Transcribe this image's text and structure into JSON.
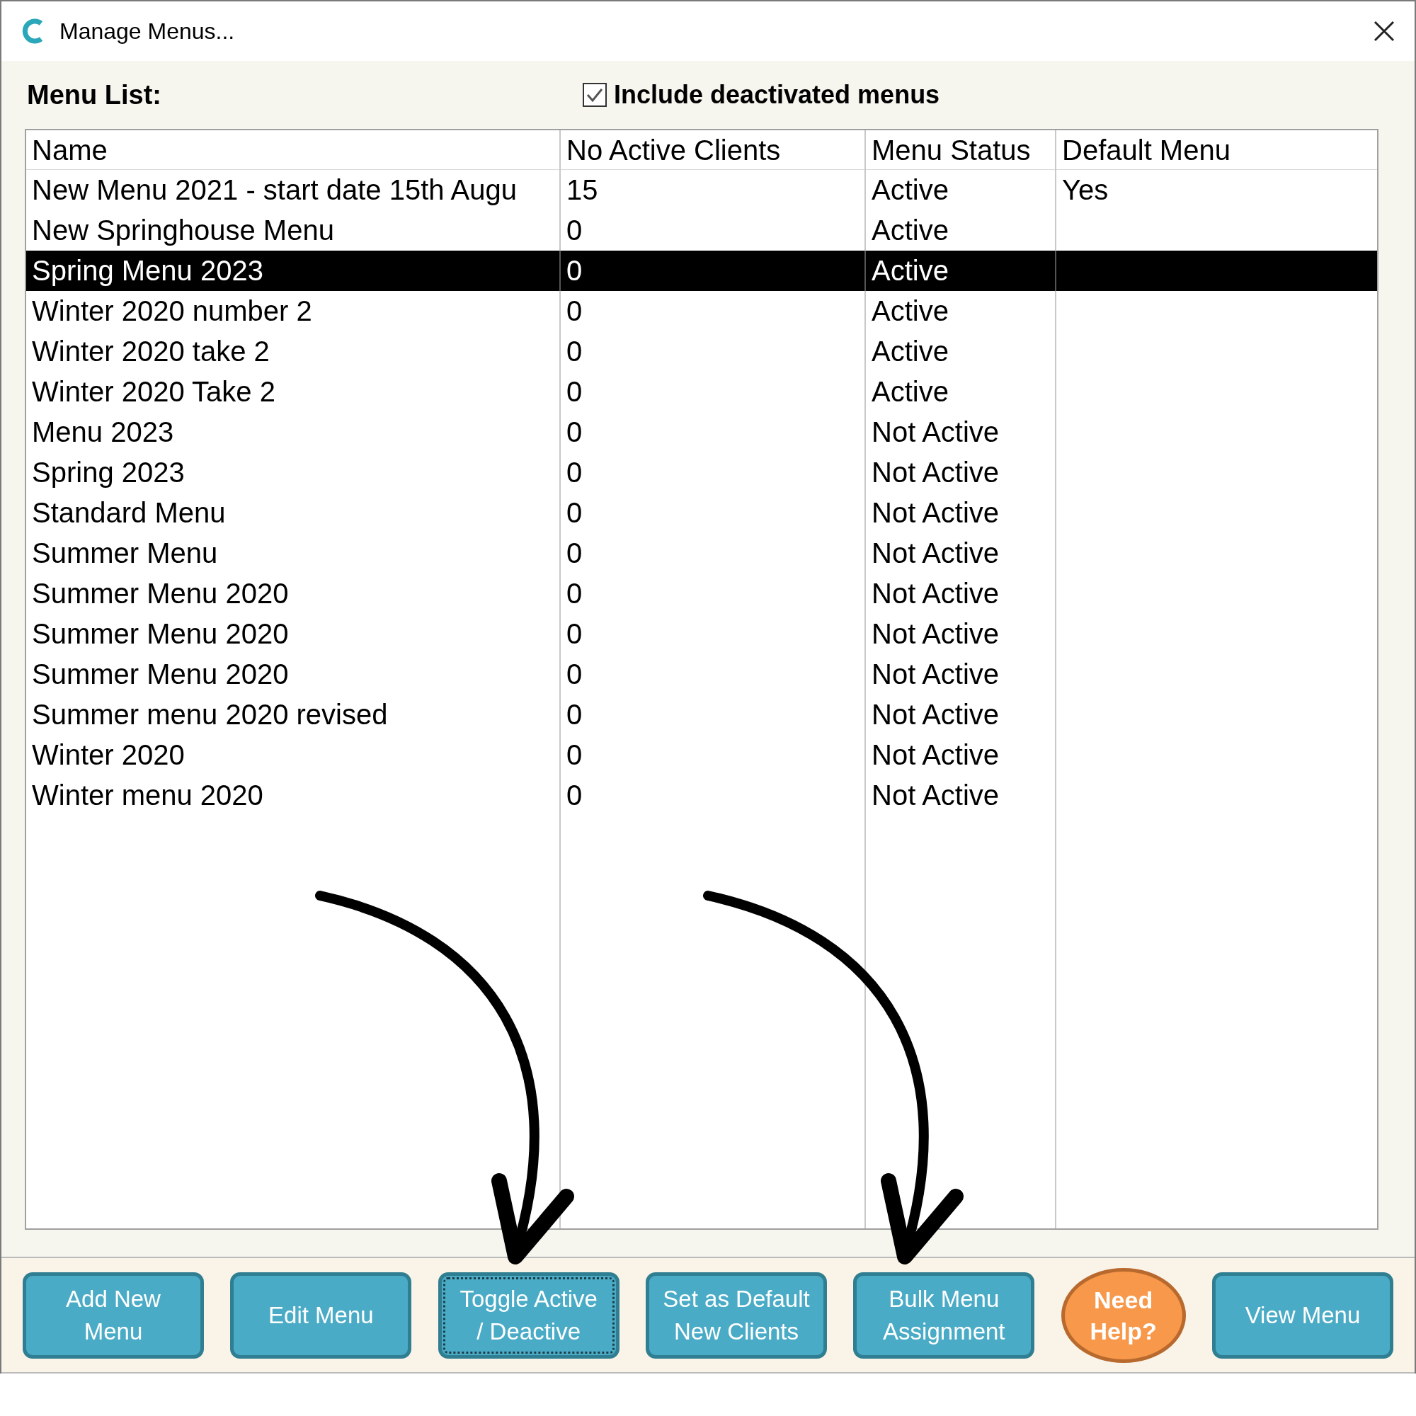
{
  "window": {
    "title": "Manage Menus..."
  },
  "menu_list": {
    "label": "Menu List:",
    "include_deactivated": {
      "label": "Include deactivated menus",
      "checked": true
    }
  },
  "table": {
    "columns": [
      "Name",
      "No Active Clients",
      "Menu Status",
      "Default Menu"
    ],
    "rows": [
      {
        "cells": [
          "New Menu 2021 - start date 15th Augu",
          "15",
          "Active",
          "Yes"
        ],
        "selected": false
      },
      {
        "cells": [
          "New Springhouse Menu",
          "0",
          "Active",
          ""
        ],
        "selected": false
      },
      {
        "cells": [
          "Spring Menu 2023",
          "0",
          "Active",
          ""
        ],
        "selected": true
      },
      {
        "cells": [
          "Winter 2020 number 2",
          "0",
          "Active",
          ""
        ],
        "selected": false
      },
      {
        "cells": [
          "Winter 2020 take 2",
          "0",
          "Active",
          ""
        ],
        "selected": false
      },
      {
        "cells": [
          "Winter 2020 Take 2",
          "0",
          "Active",
          ""
        ],
        "selected": false
      },
      {
        "cells": [
          "Menu 2023",
          "0",
          "Not Active",
          ""
        ],
        "selected": false
      },
      {
        "cells": [
          "Spring 2023",
          "0",
          "Not Active",
          ""
        ],
        "selected": false
      },
      {
        "cells": [
          "Standard Menu",
          "0",
          "Not Active",
          ""
        ],
        "selected": false
      },
      {
        "cells": [
          "Summer Menu",
          "0",
          "Not Active",
          ""
        ],
        "selected": false
      },
      {
        "cells": [
          "Summer Menu 2020",
          "0",
          "Not Active",
          ""
        ],
        "selected": false
      },
      {
        "cells": [
          "Summer Menu 2020",
          "0",
          "Not Active",
          ""
        ],
        "selected": false
      },
      {
        "cells": [
          "Summer Menu 2020",
          "0",
          "Not Active",
          ""
        ],
        "selected": false
      },
      {
        "cells": [
          "Summer menu 2020 revised",
          "0",
          "Not Active",
          ""
        ],
        "selected": false
      },
      {
        "cells": [
          "Winter 2020",
          "0",
          "Not Active",
          ""
        ],
        "selected": false
      },
      {
        "cells": [
          "Winter menu 2020",
          "0",
          "Not Active",
          ""
        ],
        "selected": false
      }
    ]
  },
  "buttons": [
    {
      "lines": [
        "Add New",
        "Menu"
      ],
      "kind": "action",
      "focused": false
    },
    {
      "lines": [
        "Edit Menu"
      ],
      "kind": "action",
      "focused": false
    },
    {
      "lines": [
        "Toggle Active",
        "/ Deactive"
      ],
      "kind": "action",
      "focused": true
    },
    {
      "lines": [
        "Set as Default",
        "New Clients"
      ],
      "kind": "action",
      "focused": false
    },
    {
      "lines": [
        "Bulk Menu",
        "Assignment"
      ],
      "kind": "action",
      "focused": false
    },
    {
      "lines": [
        "Need",
        "Help?"
      ],
      "kind": "help",
      "focused": false
    },
    {
      "lines": [
        "View Menu"
      ],
      "kind": "action",
      "focused": false
    }
  ]
}
